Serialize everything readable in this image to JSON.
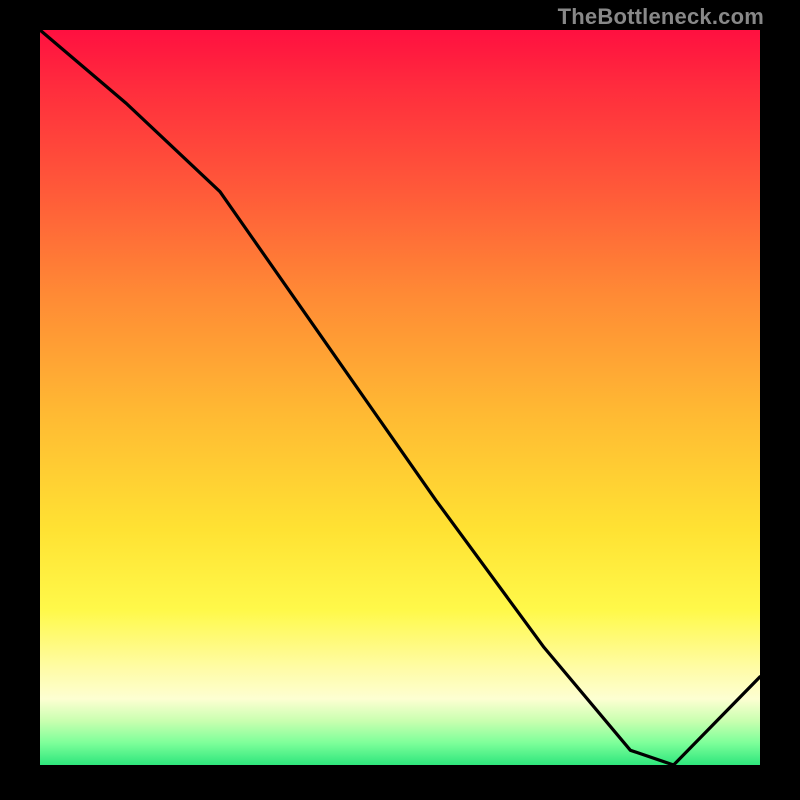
{
  "watermark": "TheBottleneck.com",
  "marker_label": "",
  "chart_data": {
    "type": "line",
    "title": "",
    "xlabel": "",
    "ylabel": "",
    "xlim": [
      0,
      100
    ],
    "ylim": [
      0,
      100
    ],
    "grid": false,
    "legend": false,
    "series": [
      {
        "name": "curve",
        "x": [
          0,
          12,
          25,
          40,
          55,
          70,
          82,
          88,
          100
        ],
        "y": [
          100,
          90,
          78,
          57,
          36,
          16,
          2,
          0,
          12
        ]
      }
    ],
    "annotations": [
      {
        "x": 82,
        "y": 0.5,
        "text": ""
      }
    ],
    "background_gradient_stops": [
      {
        "pos": 0.0,
        "color": "#ff1040"
      },
      {
        "pos": 0.08,
        "color": "#ff2d3d"
      },
      {
        "pos": 0.22,
        "color": "#ff5a39"
      },
      {
        "pos": 0.36,
        "color": "#ff8a35"
      },
      {
        "pos": 0.52,
        "color": "#ffb933"
      },
      {
        "pos": 0.68,
        "color": "#ffe233"
      },
      {
        "pos": 0.79,
        "color": "#fff94a"
      },
      {
        "pos": 0.87,
        "color": "#fffca8"
      },
      {
        "pos": 0.91,
        "color": "#fdffd2"
      },
      {
        "pos": 0.94,
        "color": "#c9ffb0"
      },
      {
        "pos": 0.97,
        "color": "#7dff9a"
      },
      {
        "pos": 1.0,
        "color": "#2ee67c"
      }
    ]
  }
}
